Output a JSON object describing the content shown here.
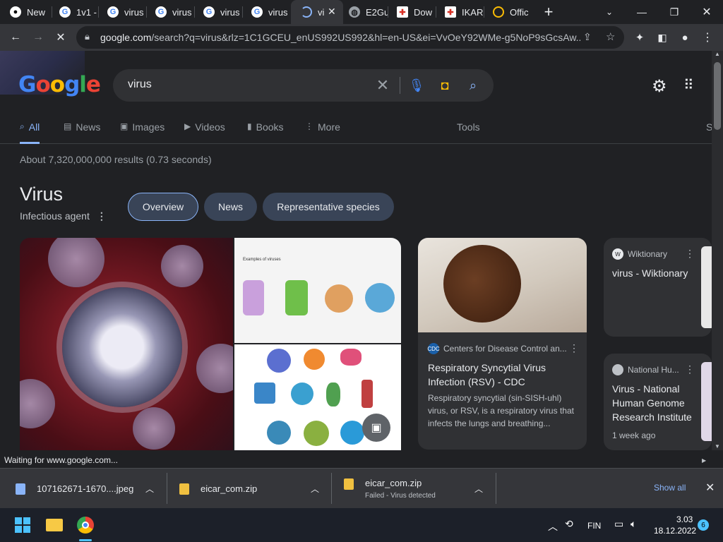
{
  "browser": {
    "tabs": [
      {
        "label": "New",
        "icon": "github-icon"
      },
      {
        "label": "1v1 -",
        "icon": "google-icon"
      },
      {
        "label": "virus",
        "icon": "google-icon"
      },
      {
        "label": "virus",
        "icon": "google-icon"
      },
      {
        "label": "virus",
        "icon": "google-icon"
      },
      {
        "label": "virus",
        "icon": "google-icon"
      },
      {
        "label": "vi",
        "icon": "loading-icon"
      },
      {
        "label": "E2Gu",
        "icon": "globe-icon"
      },
      {
        "label": "Dow",
        "icon": "ikarus-icon"
      },
      {
        "label": "IKAR",
        "icon": "ikarus-icon"
      },
      {
        "label": "Offic",
        "icon": "loading-ring-icon"
      }
    ],
    "url_domain": "google.com",
    "url_rest": "/search?q=virus&rlz=1C1GCEU_enUS992US992&hl=en-US&ei=VvOeY92WMe-g5NoP9sGcsAw..."
  },
  "google": {
    "logo": "Google",
    "query": "virus",
    "tabs": [
      "All",
      "News",
      "Images",
      "Videos",
      "Books",
      "More"
    ],
    "tools": "Tools",
    "safe": "S",
    "stats": "About 7,320,000,000 results (0.73 seconds)"
  },
  "knowledge": {
    "title": "Virus",
    "subtitle": "Infectious agent",
    "chips": [
      "Overview",
      "News",
      "Representative species"
    ],
    "image_caption": "Examples of viruses"
  },
  "cards": {
    "cdc": {
      "source": "Centers for Disease Control an...",
      "source_icon": "CDC",
      "title": "Respiratory Syncytial Virus Infection (RSV) - CDC",
      "snippet": "Respiratory syncytial (sin-SISH-uhl) virus, or RSV, is a respiratory virus that infects the lungs and breathing..."
    },
    "wiktionary": {
      "source": "Wiktionary",
      "source_icon": "W",
      "title": "virus - Wiktionary"
    },
    "nhgri": {
      "source": "National Hu...",
      "title": "Virus - National Human Genome Research Institute",
      "time": "1 week ago"
    }
  },
  "status_text": "Waiting for www.google.com...",
  "downloads": {
    "items": [
      {
        "name": "107162671-1670....jpeg",
        "status": ""
      },
      {
        "name": "eicar_com.zip",
        "status": ""
      },
      {
        "name": "eicar_com.zip",
        "status": "Failed - Virus detected"
      }
    ],
    "show_all": "Show all"
  },
  "taskbar": {
    "language": "FIN",
    "time": "3.03",
    "date": "18.12.2022",
    "notifications": "6"
  },
  "colors": {
    "accent": "#8ab4f8",
    "chip_bg": "#394457",
    "bg": "#202124"
  }
}
